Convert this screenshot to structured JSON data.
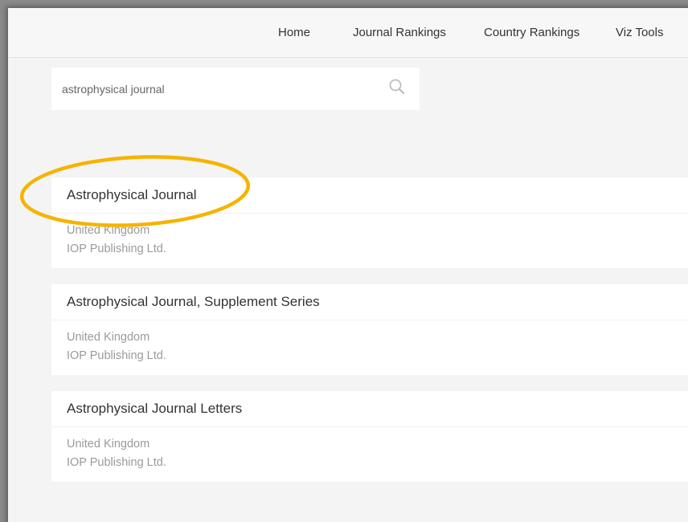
{
  "nav": {
    "items": [
      {
        "label": "Home"
      },
      {
        "label": "Journal Rankings"
      },
      {
        "label": "Country Rankings"
      },
      {
        "label": "Viz Tools"
      }
    ]
  },
  "search": {
    "value": "astrophysical journal",
    "icon": "search-icon"
  },
  "results": [
    {
      "title": "Astrophysical Journal",
      "country": "United Kingdom",
      "publisher": "IOP Publishing Ltd."
    },
    {
      "title": "Astrophysical Journal, Supplement Series",
      "country": "United Kingdom",
      "publisher": "IOP Publishing Ltd."
    },
    {
      "title": "Astrophysical Journal Letters",
      "country": "United Kingdom",
      "publisher": "IOP Publishing Ltd."
    }
  ],
  "colors": {
    "highlight": "#f5b400",
    "page_background": "#f4f4f4"
  }
}
